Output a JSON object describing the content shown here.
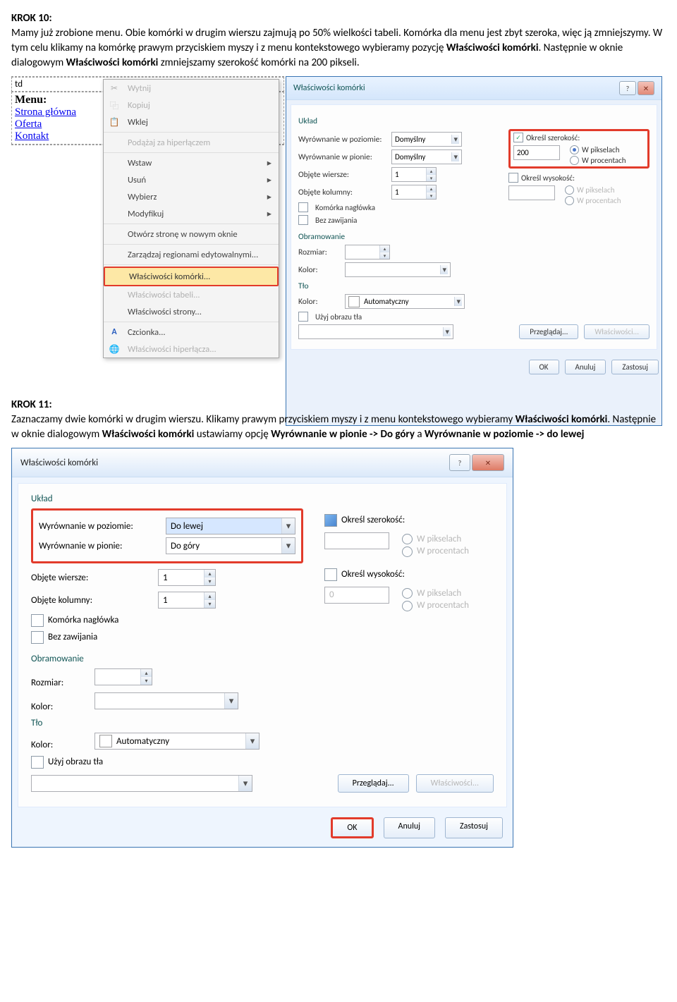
{
  "k10": {
    "title": "KROK 10:",
    "p1": "Mamy już zrobione menu. Obie komórki w drugim wierszu zajmują po 50% wielkości tabeli. Komórka dla menu jest zbyt szeroka, więc ją zmniejszymy. W tym celu klikamy na komórkę prawym przyciskiem myszy i z menu kontekstowego wybieramy pozycję ",
    "b1": "Właściwości komórki",
    "p2": ". Następnie w oknie dialogowym ",
    "b2": "Właściwości komórki",
    "p3": " zmniejszamy szerokość komórki na 200 pikseli.",
    "td": "td",
    "menu": "Menu:",
    "links": [
      "Strona główna",
      "Oferta",
      "Kontakt"
    ]
  },
  "ctx": {
    "wytnij": "Wytnij",
    "kopiuj": "Kopiuj",
    "wklej": "Wklej",
    "podazaj": "Podążaj za hiperłączem",
    "wstaw": "Wstaw",
    "usun": "Usuń",
    "wybierz": "Wybierz",
    "modyfikuj": "Modyfikuj",
    "otworz": "Otwórz stronę w nowym oknie",
    "zarzadzaj": "Zarządzaj regionami edytowalnymi...",
    "wlasKom": "Właściwości komórki...",
    "wlasTab": "Właściwości tabeli...",
    "wlasStr": "Właściwości strony...",
    "czcionka": "Czcionka...",
    "wlasHip": "Właściwości hiperłącza..."
  },
  "dlg1": {
    "title": "Właściwości komórki",
    "uklad": "Układ",
    "wPoziom": "Wyrównanie w poziomie:",
    "domyslny": "Domyślny",
    "wPion": "Wyrównanie w pionie:",
    "objW": "Objęte wiersze:",
    "one": "1",
    "objK": "Objęte kolumny:",
    "komN": "Komórka nagłówka",
    "bezZ": "Bez zawijania",
    "okrS": "Określ szerokość:",
    "val200": "200",
    "wpik": "W pikselach",
    "wproc": "W procentach",
    "okrW": "Określ wysokość:",
    "obr": "Obramowanie",
    "rozm": "Rozmiar:",
    "kolor": "Kolor:",
    "tlo": "Tło",
    "auto": "Automatyczny",
    "uzyj": "Użyj obrazu tła",
    "przeg": "Przeglądaj...",
    "wlasc": "Właściwości...",
    "ok": "OK",
    "anuluj": "Anuluj",
    "zastosuj": "Zastosuj"
  },
  "k11": {
    "title": "KROK 11:",
    "p1": "Zaznaczamy dwie komórki w drugim wierszu. Klikamy prawym przyciskiem myszy i z menu kontekstowego wybieramy ",
    "b1": "Właściwości komórki",
    "p2": ". Następnie w oknie dialogowym ",
    "b2": "Właściwości komórki",
    "p3": " ustawiamy opcję ",
    "b3": "Wyrównanie w pionie -> Do góry",
    "p4": " a ",
    "b4": "Wyrównanie w poziomie -> do lewej"
  },
  "dlg2": {
    "title": "Właściwości komórki",
    "uklad": "Układ",
    "wPoziom": "Wyrównanie w poziomie:",
    "doLewej": "Do lewej",
    "wPion": "Wyrównanie w pionie:",
    "doGory": "Do góry",
    "objW": "Objęte wiersze:",
    "one": "1",
    "objK": "Objęte kolumny:",
    "komN": "Komórka nagłówka",
    "bezZ": "Bez zawijania",
    "okrS": "Określ szerokość:",
    "okrW": "Określ wysokość:",
    "zero": "0",
    "wpik": "W pikselach",
    "wproc": "W procentach",
    "obr": "Obramowanie",
    "rozm": "Rozmiar:",
    "kolor": "Kolor:",
    "tlo": "Tło",
    "auto": "Automatyczny",
    "uzyj": "Użyj obrazu tła",
    "przeg": "Przeglądaj...",
    "wlasc": "Właściwości...",
    "ok": "OK",
    "anuluj": "Anuluj",
    "zastosuj": "Zastosuj"
  }
}
